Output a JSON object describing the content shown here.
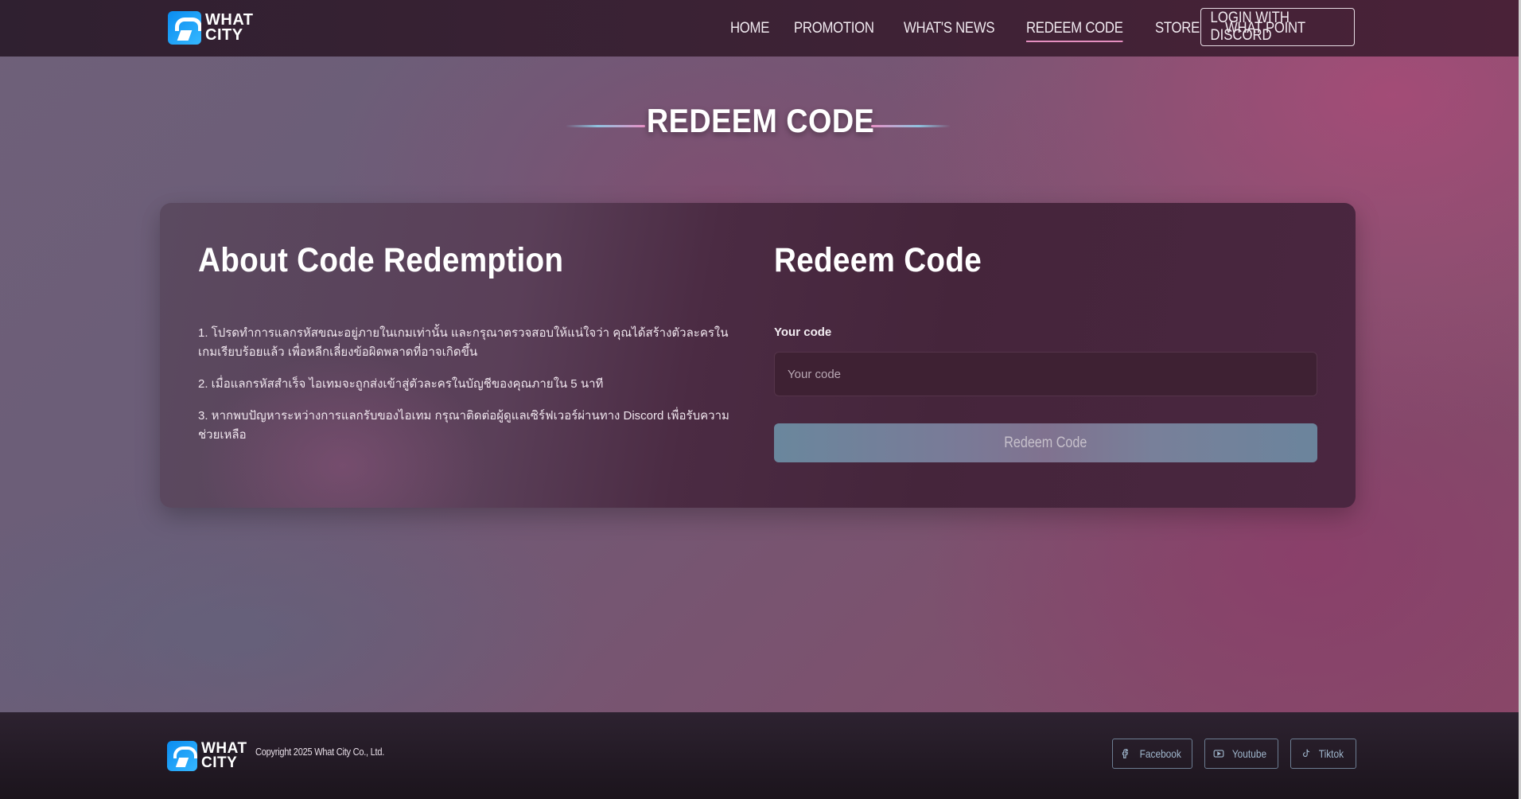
{
  "brand": {
    "logo_line1": "WHAT",
    "logo_line2": "CITY"
  },
  "nav": {
    "items": [
      {
        "label": "HOME"
      },
      {
        "label": "PROMOTION"
      },
      {
        "label": "WHAT'S NEWS"
      },
      {
        "label": "REDEEM CODE",
        "active": true
      },
      {
        "label": "STORE"
      },
      {
        "label": "WHAT POINT"
      }
    ],
    "login_label": "LOGIN WITH DISCORD"
  },
  "page": {
    "title": "REDEEM CODE"
  },
  "about": {
    "title": "About Code Redemption",
    "items": [
      "1. โปรดทำการแลกรหัสขณะอยู่ภายในเกมเท่านั้น และกรุณาตรวจสอบให้แน่ใจว่า คุณได้สร้างตัวละครในเกมเรียบร้อยแล้ว เพื่อหลีกเลี่ยงข้อผิดพลาดที่อาจเกิดขึ้น",
      "2. เมื่อแลกรหัสสำเร็จ ไอเทมจะถูกส่งเข้าสู่ตัวละครในบัญชีของคุณภายใน 5 นาที",
      "3. หากพบปัญหาระหว่างการแลกรับของไอเทม กรุณาติดต่อผู้ดูแลเซิร์ฟเวอร์ผ่านทาง Discord เพื่อรับความช่วยเหลือ"
    ]
  },
  "redeem": {
    "title": "Redeem Code",
    "field_label": "Your code",
    "placeholder": "Your code",
    "value": "",
    "button_label": "Redeem Code"
  },
  "footer": {
    "copyright": "Copyright 2025 What City Co., Ltd.",
    "socials": [
      {
        "label": "Facebook",
        "icon": "facebook-icon"
      },
      {
        "label": "Youtube",
        "icon": "youtube-icon"
      },
      {
        "label": "Tiktok",
        "icon": "tiktok-icon"
      }
    ]
  },
  "colors": {
    "accent": "#e58fc0",
    "button": "#7a7a97",
    "social_border": "#6c7d92"
  }
}
